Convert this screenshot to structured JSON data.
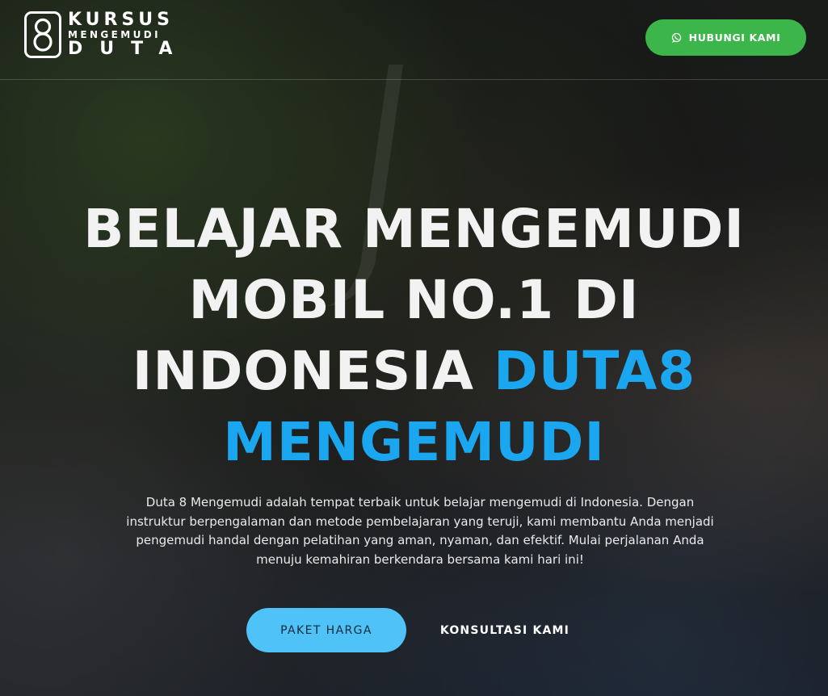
{
  "brand": {
    "logo_mark": "8",
    "line1": "KURSUS",
    "line2": "MENGEMUDI",
    "line3": "DUTA"
  },
  "header": {
    "cta_label": "HUBUNGI KAMI",
    "cta_icon": "whatsapp-icon",
    "cta_color": "#3cb54a"
  },
  "hero": {
    "headline_part1": "BELAJAR MENGEMUDI MOBIL NO.1 DI INDONESIA ",
    "headline_accent": "DUTA8 MENGEMUDI",
    "accent_color": "#1aa7f0",
    "description": "Duta 8 Mengemudi adalah tempat terbaik untuk belajar mengemudi di Indonesia. Dengan instruktur berpengalaman dan metode pembelajaran yang teruji, kami membantu Anda menjadi pengemudi handal dengan pelatihan yang aman, nyaman, dan efektif. Mulai perjalanan Anda menuju kemahiran berkendara bersama kami hari ini!",
    "primary_button": "PAKET HARGA",
    "primary_color": "#4fc3f7",
    "secondary_button": "KONSULTASI KAMI"
  }
}
